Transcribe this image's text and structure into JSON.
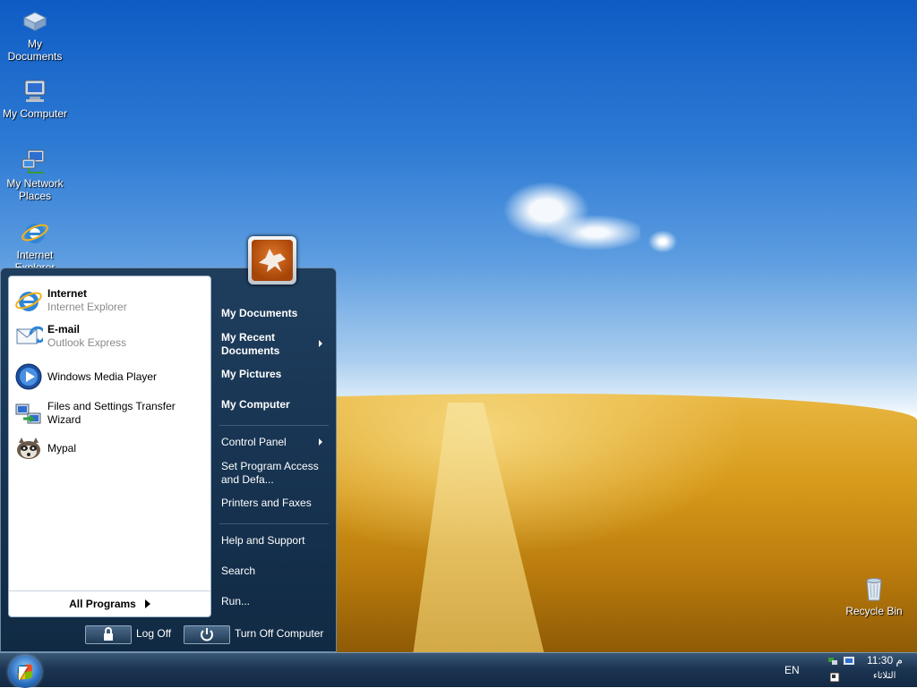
{
  "desktop": {
    "icons": [
      {
        "label": "My Documents",
        "icon": "my-documents-icon"
      },
      {
        "label": "My Computer",
        "icon": "my-computer-icon"
      },
      {
        "label": "My Network Places",
        "icon": "network-places-icon"
      },
      {
        "label": "Internet Explorer",
        "icon": "internet-explorer-icon"
      },
      {
        "label": "Recycle Bin",
        "icon": "recycle-bin-icon"
      }
    ]
  },
  "start_menu": {
    "pinned": [
      {
        "title": "Internet",
        "subtitle": "Internet Explorer",
        "icon": "internet-explorer-icon"
      },
      {
        "title": "E-mail",
        "subtitle": "Outlook Express",
        "icon": "outlook-express-icon"
      }
    ],
    "recent": [
      {
        "title": "Windows Media Player",
        "icon": "media-player-icon"
      },
      {
        "title": "Files and Settings Transfer Wizard",
        "icon": "transfer-wizard-icon"
      },
      {
        "title": "Mypal",
        "icon": "mypal-icon"
      }
    ],
    "all_programs": "All Programs",
    "right": {
      "my_documents": "My Documents",
      "my_recent_documents": "My Recent Documents",
      "my_pictures": "My Pictures",
      "my_computer": "My Computer",
      "control_panel": "Control Panel",
      "set_program_access": "Set Program Access and Defa...",
      "printers_faxes": "Printers and Faxes",
      "help_support": "Help and Support",
      "search": "Search",
      "run": "Run..."
    },
    "log_off": "Log Off",
    "turn_off": "Turn Off Computer"
  },
  "taskbar": {
    "language": "EN",
    "clock_time": "11:30 م",
    "clock_day": "الثلاثاء"
  },
  "colors": {
    "menu_bg": "#16324f",
    "taskbar": "#1c3552"
  }
}
